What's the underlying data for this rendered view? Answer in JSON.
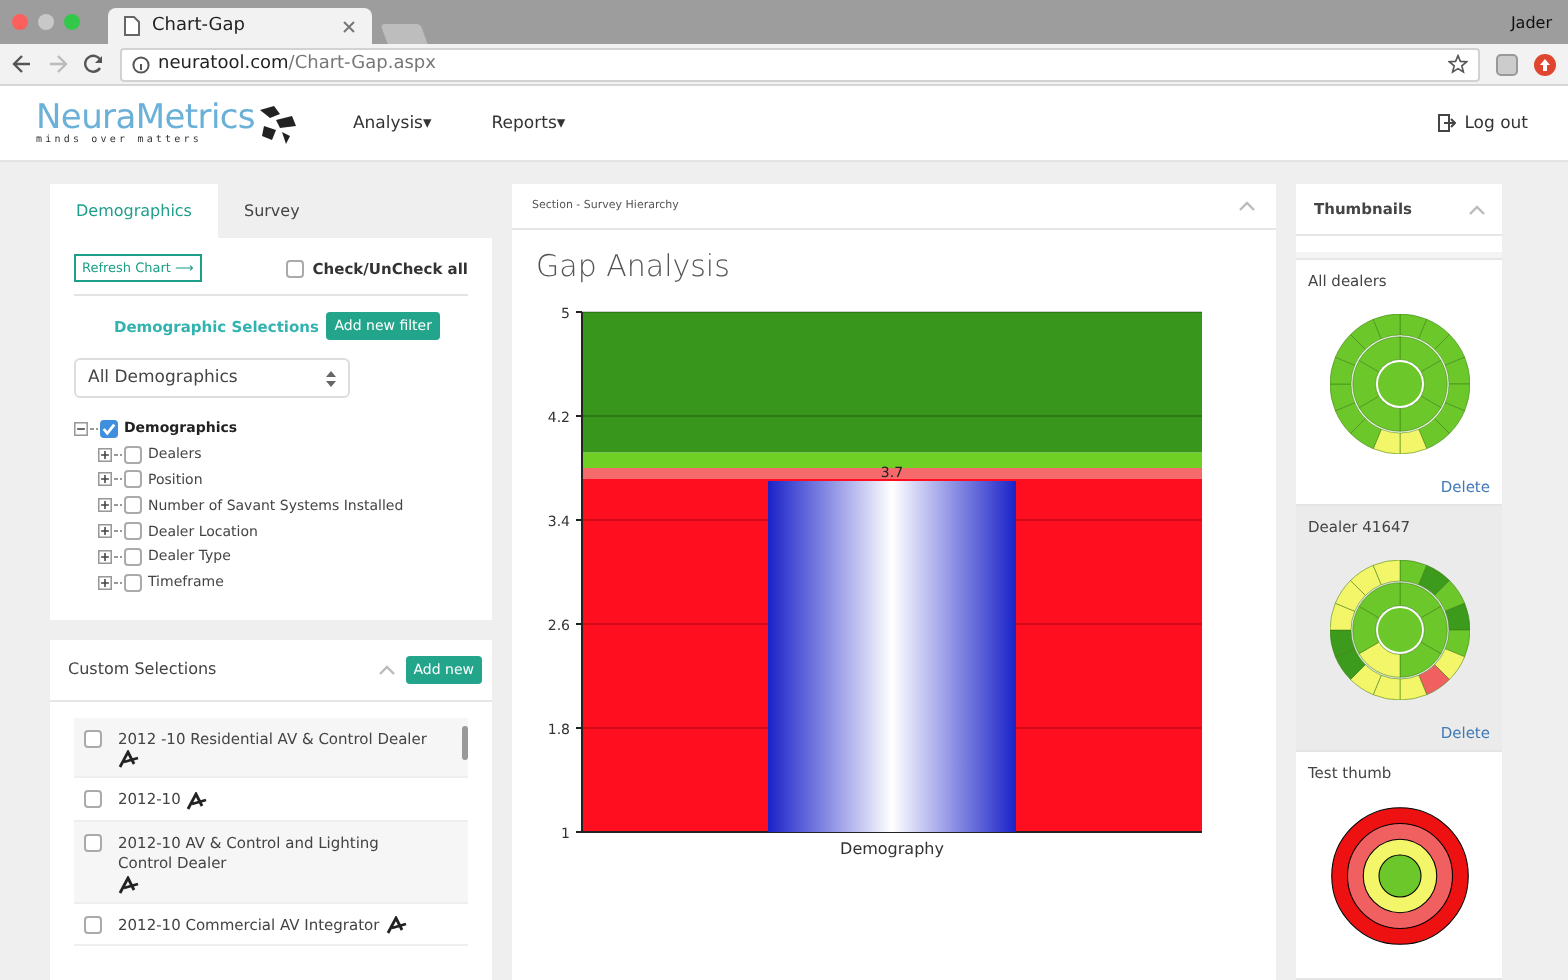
{
  "browser": {
    "tab_title": "Chart-Gap",
    "profile": "Jader",
    "url_host": "neuratool.com",
    "url_path": "/Chart-Gap.aspx"
  },
  "nav": {
    "logo": "NeuraMetrics",
    "tagline": "minds over matters",
    "menus": [
      {
        "label": "Analysis",
        "caret": "▾"
      },
      {
        "label": "Reports",
        "caret": "▾"
      }
    ],
    "logout": "Log out"
  },
  "filters": {
    "tabs": [
      {
        "label": "Demographics",
        "selected": true
      },
      {
        "label": "Survey",
        "selected": false
      }
    ],
    "refresh": "Refresh Chart ⟶",
    "check_all": {
      "label": "Check/UnCheck all",
      "checked": false
    },
    "heading": "Demographic Selections",
    "add_filter": "Add new filter",
    "select": "All Demographics",
    "tree": {
      "label": "Demographics",
      "checked": true,
      "expanded": true,
      "children": [
        {
          "label": "Dealers",
          "checked": false,
          "expanded": false
        },
        {
          "label": "Position",
          "checked": false,
          "expanded": false
        },
        {
          "label": "Number of Savant Systems Installed",
          "checked": false,
          "expanded": false
        },
        {
          "label": "Dealer Location",
          "checked": false,
          "expanded": false
        },
        {
          "label": "Dealer Type",
          "checked": false,
          "expanded": false
        },
        {
          "label": "Timeframe",
          "checked": false,
          "expanded": false
        }
      ]
    }
  },
  "custom": {
    "title": "Custom Selections",
    "add": "Add new",
    "items": [
      {
        "label": "2012 -10 Residential AV & Control Dealer",
        "checked": false
      },
      {
        "label": "2012-10",
        "checked": false
      },
      {
        "label": "2012-10 AV & Control and Lighting Control Dealer",
        "checked": false
      },
      {
        "label": "2012-10 Commercial AV Integrator",
        "checked": false
      }
    ]
  },
  "section": {
    "header": "Section - Survey Hierarchy",
    "title": "Gap Analysis",
    "chart_data": {
      "type": "bar",
      "categories": [
        "Demography"
      ],
      "values": [
        3.7
      ],
      "ylim": [
        1,
        5
      ],
      "yticks": [
        1,
        1.8,
        2.6,
        3.4,
        4.2,
        5
      ],
      "data_labels": true,
      "grid": true
    }
  },
  "thumbnails": {
    "title": "Thumbnails",
    "items": [
      {
        "label": "All dealers",
        "kind": "sunburst",
        "delete": "Delete",
        "selected": false
      },
      {
        "label": "Dealer 41647",
        "kind": "sunburst-mixed",
        "delete": "Delete",
        "selected": true
      },
      {
        "label": "Test thumb",
        "kind": "target",
        "selected": false
      }
    ]
  }
}
